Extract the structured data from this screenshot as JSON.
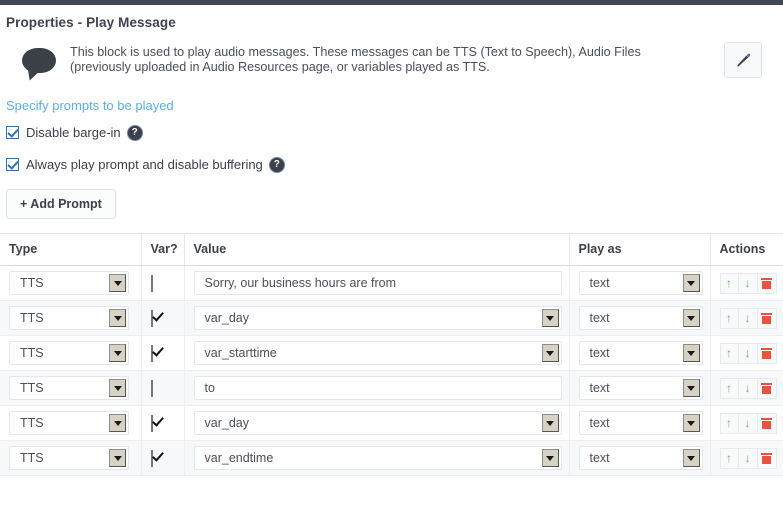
{
  "panel": {
    "title": "Properties - Play Message",
    "description": "This block is used to play audio messages. These messages can be TTS (Text to Speech), Audio Files (previously uploaded in Audio Resources page, or variables played as TTS.",
    "edit_icon": "pencil-icon",
    "bubble_icon": "speech-bubble-icon"
  },
  "section": {
    "link_label": "Specify prompts to be played"
  },
  "options": [
    {
      "label": "Disable barge-in",
      "checked": true,
      "help_icon": "help-icon"
    },
    {
      "label": "Always play prompt and disable buffering",
      "checked": true,
      "help_icon": "help-icon"
    }
  ],
  "toolbar": {
    "add_prompt_label": "+ Add Prompt"
  },
  "table": {
    "headers": [
      "Type",
      "Var?",
      "Value",
      "Play as",
      "Actions"
    ],
    "rows": [
      {
        "type": "TTS",
        "is_var": false,
        "value": "Sorry, our business hours are from",
        "play_as": "text"
      },
      {
        "type": "TTS",
        "is_var": true,
        "value": "var_day",
        "play_as": "text"
      },
      {
        "type": "TTS",
        "is_var": true,
        "value": "var_starttime",
        "play_as": "text"
      },
      {
        "type": "TTS",
        "is_var": false,
        "value": "to",
        "play_as": "text"
      },
      {
        "type": "TTS",
        "is_var": true,
        "value": "var_day",
        "play_as": "text"
      },
      {
        "type": "TTS",
        "is_var": true,
        "value": "var_endtime",
        "play_as": "text"
      }
    ],
    "actions": {
      "move_up_icon": "arrow-up-icon",
      "move_down_icon": "arrow-down-icon",
      "delete_icon": "trash-icon"
    }
  },
  "colors": {
    "link": "#5bafe4",
    "topbar": "#434857",
    "checkbox_accent": "#2e74b5",
    "action_up": "#5cb85c",
    "action_delete": "#e8533f"
  }
}
